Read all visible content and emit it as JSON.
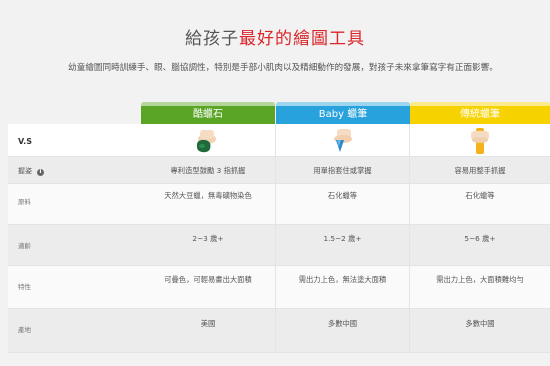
{
  "header": {
    "title_plain": "給孩子",
    "title_highlight": "最好的繪圖工具",
    "subtitle": "幼童繪圖同時訓練手、眼、腦協調性，特別是手部小肌肉以及精細動作的發展，對孩子未來拿筆寫字有正面影響。"
  },
  "columns": [
    {
      "name": "酷蠟石",
      "color": "#5aa426",
      "icon": "crayon-rock-in-hand-icon"
    },
    {
      "name": "Baby 蠟筆",
      "color": "#27a2dc",
      "icon": "baby-crayon-in-hand-icon"
    },
    {
      "name": "傳統蠟筆",
      "color": "#f6d200",
      "icon": "traditional-crayon-in-hand-icon"
    }
  ],
  "vs_label": "V.S",
  "rows": [
    {
      "label": "握姿",
      "info_icon": "info-icon",
      "values": [
        "專利造型鼓勵 3 指抓握",
        "用單指套住或掌握",
        "容易用整手抓握"
      ]
    },
    {
      "label": "原料",
      "values": [
        "天然大豆蠟，無毒礦物染色",
        "石化蠟等",
        "石化蠟等"
      ]
    },
    {
      "label": "適齡",
      "values": [
        "2~3 歲+",
        "1.5~2 歲+",
        "5~6 歲+"
      ]
    },
    {
      "label": "特性",
      "values": [
        "可疊色，可輕易畫出大面積",
        "需出力上色，無法塗大面積",
        "需出力上色，大面積難均勻"
      ]
    },
    {
      "label": "產地",
      "values": [
        "美國",
        "多數中國",
        "多數中國"
      ]
    }
  ]
}
